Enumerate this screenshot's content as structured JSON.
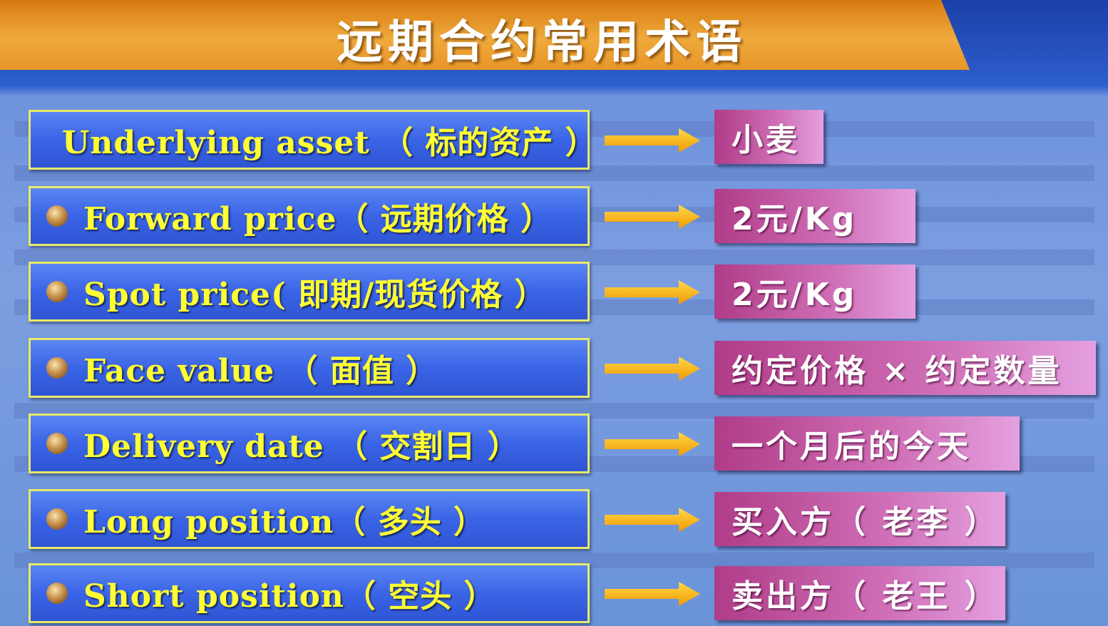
{
  "title": "远期合约常用术语",
  "colors": {
    "term_bg": "#3a64e6",
    "term_text": "#ffff33",
    "value_bg": "#c050a0",
    "arrow": "#f5b400",
    "banner": "#eda030"
  },
  "rows": [
    {
      "term": "Underlying asset （ 标的资产 ）",
      "value": "小麦"
    },
    {
      "term": "Forward price（ 远期价格 ）",
      "value": "2元/Kg"
    },
    {
      "term": "Spot price( 即期/现货价格 ）",
      "value": "2元/Kg"
    },
    {
      "term": "Face value （ 面值 ）",
      "value": "约定价格 × 约定数量"
    },
    {
      "term": "Delivery date （ 交割日 ）",
      "value": "一个月后的今天"
    },
    {
      "term": "Long position（ 多头 ）",
      "value": "买入方（ 老李 ）"
    },
    {
      "term": "Short position（ 空头 ）",
      "value": "卖出方（ 老王 ）"
    }
  ]
}
